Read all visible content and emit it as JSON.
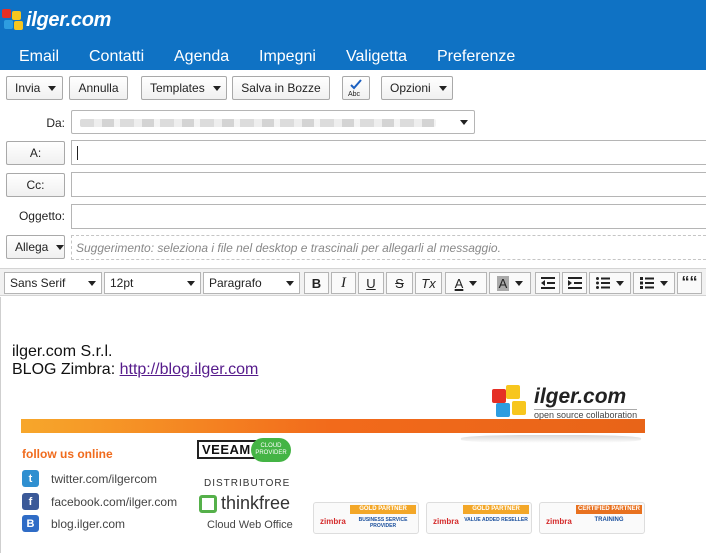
{
  "header": {
    "logo_text": "ilger.com",
    "nav": [
      "Email",
      "Contatti",
      "Agenda",
      "Impegni",
      "Valigetta",
      "Preferenze"
    ]
  },
  "toolbar": {
    "send": "Invia",
    "cancel": "Annulla",
    "templates": "Templates",
    "save_draft": "Salva in Bozze",
    "spellcheck_icon": "spellcheck-icon",
    "spellcheck_text": "Abc",
    "options": "Opzioni"
  },
  "compose": {
    "from_label": "Da:",
    "to_button": "A:",
    "cc_button": "Cc:",
    "subject_label": "Oggetto:",
    "subject_value": "",
    "to_value": "",
    "cc_value": "",
    "attach_button": "Allega",
    "attach_hint": "Suggerimento: seleziona i file nel desktop e trascinali per allegarli al messaggio."
  },
  "editor_toolbar": {
    "font_family": "Sans Serif",
    "font_size": "12pt",
    "block_format": "Paragrafo",
    "bold": "B",
    "italic": "I",
    "underline": "U",
    "strike": "S",
    "clear": "Tx",
    "font_color": "A",
    "bg_color": "A",
    "quote": "““"
  },
  "body": {
    "company": "ilger.com S.r.l.",
    "blog_label": "BLOG Zimbra:",
    "blog_link": "http://blog.ilger.com"
  },
  "signature": {
    "brand": "ilger.com",
    "brand_sub": "open source collaboration",
    "follow": "follow us online",
    "social": [
      {
        "icon": "twitter-icon",
        "text": "twitter.com/ilgercom",
        "color": "#2f8fd0",
        "glyph": "t"
      },
      {
        "icon": "facebook-icon",
        "text": "facebook.com/ilger.com",
        "color": "#3b5998",
        "glyph": "f"
      },
      {
        "icon": "blogger-icon",
        "text": "blog.ilger.com",
        "color": "#2f6cc6",
        "glyph": "B"
      }
    ],
    "veeam": "VEEAM",
    "veeam_cloud": "CLOUD PROVIDER",
    "distributor": "DISTRIBUTORE",
    "thinkfree": "thinkfree",
    "cloud_web_office": "Cloud Web Office",
    "badges": [
      {
        "brand": "zimbra",
        "title": "GOLD PARTNER",
        "sub": "BUSINESS SERVICE PROVIDER"
      },
      {
        "brand": "zimbra",
        "title": "GOLD PARTNER",
        "sub": "VALUE ADDED RESELLER"
      },
      {
        "brand": "zimbra",
        "title": "CERTIFIED PARTNER",
        "sub": "TRAINING"
      }
    ]
  },
  "colors": {
    "header_blue": "#0f72c4",
    "accent_orange": "#f06b1d"
  }
}
